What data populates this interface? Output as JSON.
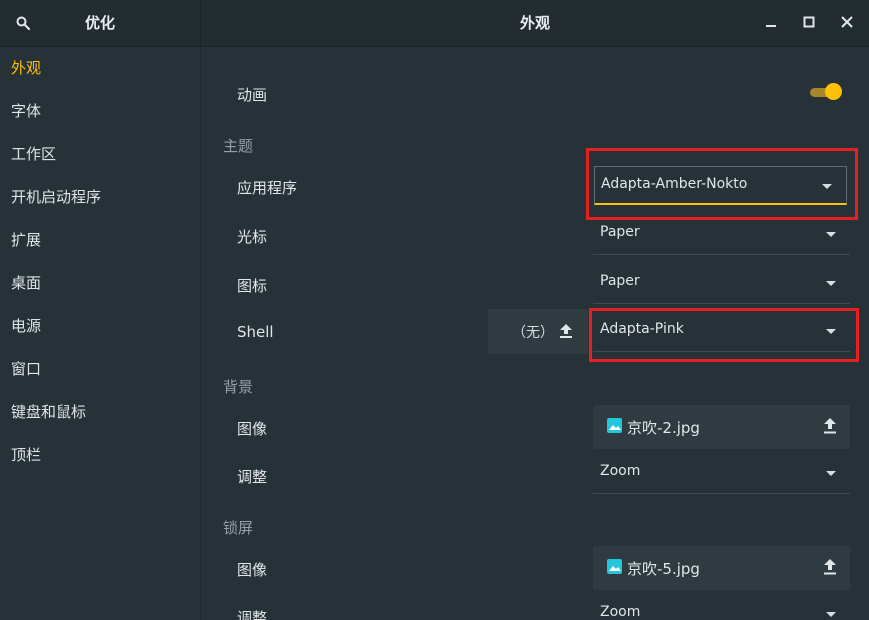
{
  "header": {
    "sidebar_title": "优化",
    "title": "外观"
  },
  "sidebar": {
    "items": [
      {
        "label": "外观",
        "active": true
      },
      {
        "label": "字体"
      },
      {
        "label": "工作区"
      },
      {
        "label": "开机启动程序"
      },
      {
        "label": "扩展"
      },
      {
        "label": "桌面"
      },
      {
        "label": "电源"
      },
      {
        "label": "窗口"
      },
      {
        "label": "键盘和鼠标"
      },
      {
        "label": "顶栏"
      }
    ]
  },
  "main": {
    "animation_label": "动画",
    "animation_enabled": true,
    "themes_section": "主题",
    "app_label": "应用程序",
    "app_value": "Adapta-Amber-Nokto",
    "cursor_label": "光标",
    "cursor_value": "Paper",
    "icons_label": "图标",
    "icons_value": "Paper",
    "shell_label": "Shell",
    "shell_none": "（无）",
    "shell_value": "Adapta-Pink",
    "background_section": "背景",
    "bg_image_label": "图像",
    "bg_image_value": "京吹-2.jpg",
    "bg_adjust_label": "调整",
    "bg_adjust_value": "Zoom",
    "lock_section": "锁屏",
    "lock_image_label": "图像",
    "lock_image_value": "京吹-5.jpg",
    "lock_adjust_label": "调整",
    "lock_adjust_value": "Zoom"
  },
  "colors": {
    "accent": "#ffc107",
    "highlight_box": "#e52020"
  }
}
